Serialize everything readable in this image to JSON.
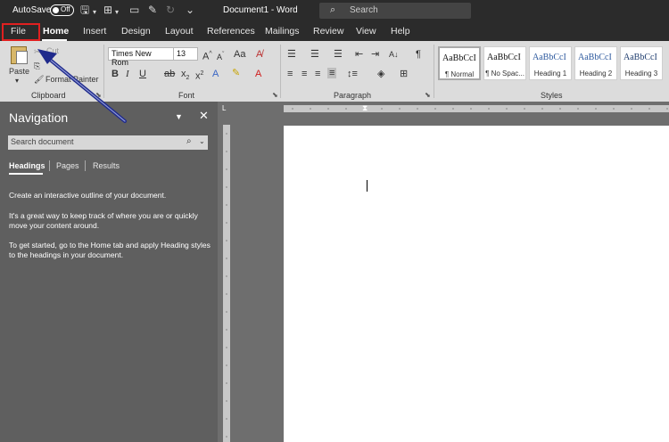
{
  "titlebar": {
    "autosave_label": "AutoSave",
    "autosave_state": "Off",
    "document_title": "Document1 - Word",
    "search_placeholder": "Search"
  },
  "tabs": [
    "File",
    "Home",
    "Insert",
    "Design",
    "Layout",
    "References",
    "Mailings",
    "Review",
    "View",
    "Help"
  ],
  "active_tab": "Home",
  "ribbon": {
    "clipboard": {
      "paste_label": "Paste",
      "cut_label": "Cut",
      "format_painter_label": "Format Painter",
      "group_label": "Clipboard"
    },
    "font": {
      "font_name": "Times New Rom",
      "font_size": "13",
      "group_label": "Font"
    },
    "paragraph": {
      "group_label": "Paragraph"
    },
    "styles": {
      "group_label": "Styles",
      "items": [
        {
          "sample": "AaBbCcI",
          "name": "¶ Normal"
        },
        {
          "sample": "AaBbCcI",
          "name": "¶ No Spac..."
        },
        {
          "sample": "AaBbCcI",
          "name": "Heading 1"
        },
        {
          "sample": "AaBbCcI",
          "name": "Heading 2"
        },
        {
          "sample": "AaBbCcI",
          "name": "Heading 3"
        }
      ]
    }
  },
  "navigation": {
    "title": "Navigation",
    "search_placeholder": "Search document",
    "tabs": [
      "Headings",
      "Pages",
      "Results"
    ],
    "paragraphs": [
      "Create an interactive outline of your document.",
      "It's a great way to keep track of where you are or quickly move your content around.",
      "To get started, go to the Home tab and apply Heading styles to the headings in your document."
    ]
  },
  "colors": {
    "titlebar_bg": "#2b2b2b",
    "ribbon_bg": "#dcdcdc",
    "nav_bg": "#5f5f5f",
    "annotation_box": "#e02020",
    "annotation_arrow": "#1f2a8c"
  }
}
